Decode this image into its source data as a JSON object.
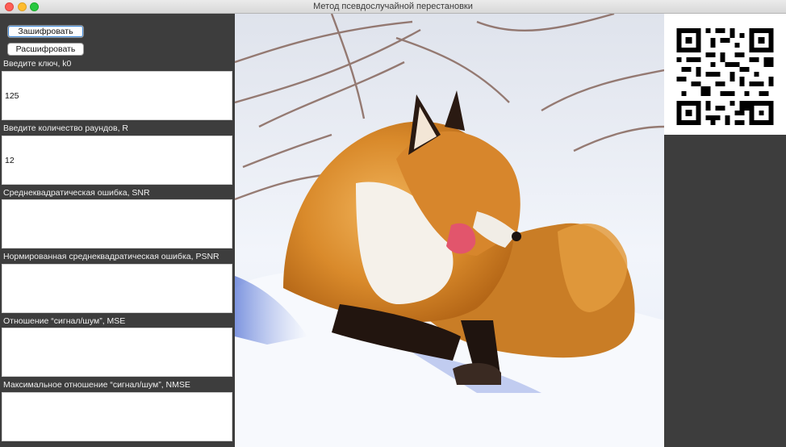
{
  "window": {
    "title": "Метод псевдослучайной перестановки"
  },
  "toolbar": {
    "encrypt_label": "Зашифровать",
    "decrypt_label": "Расшифровать"
  },
  "fields": {
    "key": {
      "label": "Введите ключ, k0",
      "value": "125"
    },
    "rounds": {
      "label": "Введите количество раундов, R",
      "value": "12"
    },
    "snr": {
      "label": "Среднеквадратическая ошибка, SNR",
      "value": ""
    },
    "psnr": {
      "label": "Нормированная среднеквадратическая ошибка, PSNR",
      "value": ""
    },
    "mse": {
      "label": "Отношение “сигнал/шум”, MSE",
      "value": ""
    },
    "nmse": {
      "label": "Максимальное отношение “сигнал/шум”, NMSE",
      "value": ""
    }
  },
  "images": {
    "main_icon": "fox-photo",
    "qr_icon": "qr-code"
  }
}
